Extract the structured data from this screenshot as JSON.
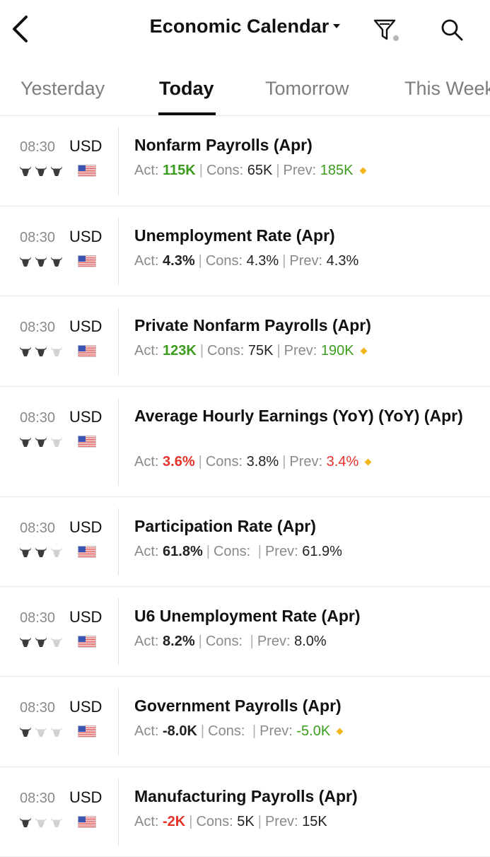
{
  "header": {
    "title": "Economic Calendar"
  },
  "tabs": [
    {
      "label": "Yesterday",
      "active": false
    },
    {
      "label": "Today",
      "active": true
    },
    {
      "label": "Tomorrow",
      "active": false
    },
    {
      "label": "This Week",
      "active": false
    }
  ],
  "icons": {
    "back": "chevron-left-icon",
    "filter": "filter-icon",
    "search": "search-icon",
    "importance": "bull-icon",
    "flag": "us-flag-icon",
    "revised": "diamond-icon"
  },
  "colors": {
    "positive": "#3c9c1e",
    "negative": "#e5332a",
    "diamond": "#f2b51c",
    "muted": "#8a8a8a"
  },
  "labels": {
    "act": "Act:",
    "cons": "Cons:",
    "prev": "Prev:"
  },
  "events": [
    {
      "time": "08:30",
      "currency": "USD",
      "importance": 3,
      "title": "Nonfarm Payrolls (Apr)",
      "actual": "115K",
      "actual_tone": "positive",
      "consensus": "65K",
      "previous": "185K",
      "previous_tone": "positive",
      "revised": true
    },
    {
      "time": "08:30",
      "currency": "USD",
      "importance": 3,
      "title": "Unemployment Rate (Apr)",
      "actual": "4.3%",
      "actual_tone": "neutral",
      "consensus": "4.3%",
      "previous": "4.3%",
      "previous_tone": "neutral",
      "revised": false
    },
    {
      "time": "08:30",
      "currency": "USD",
      "importance": 2,
      "title": "Private Nonfarm Payrolls (Apr)",
      "actual": "123K",
      "actual_tone": "positive",
      "consensus": "75K",
      "previous": "190K",
      "previous_tone": "positive",
      "revised": true
    },
    {
      "time": "08:30",
      "currency": "USD",
      "importance": 2,
      "title": "Average Hourly Earnings (YoY) (YoY) (Apr)",
      "actual": "3.6%",
      "actual_tone": "negative",
      "consensus": "3.8%",
      "previous": "3.4%",
      "previous_tone": "negative",
      "revised": true
    },
    {
      "time": "08:30",
      "currency": "USD",
      "importance": 2,
      "title": "Participation Rate (Apr)",
      "actual": "61.8%",
      "actual_tone": "neutral",
      "consensus": "",
      "previous": "61.9%",
      "previous_tone": "neutral",
      "revised": false
    },
    {
      "time": "08:30",
      "currency": "USD",
      "importance": 2,
      "title": "U6 Unemployment Rate (Apr)",
      "actual": "8.2%",
      "actual_tone": "neutral",
      "consensus": "",
      "previous": "8.0%",
      "previous_tone": "neutral",
      "revised": false
    },
    {
      "time": "08:30",
      "currency": "USD",
      "importance": 1,
      "title": "Government Payrolls (Apr)",
      "actual": "-8.0K",
      "actual_tone": "neutral",
      "consensus": "",
      "previous": "-5.0K",
      "previous_tone": "positive",
      "revised": true
    },
    {
      "time": "08:30",
      "currency": "USD",
      "importance": 1,
      "title": "Manufacturing Payrolls (Apr)",
      "actual": "-2K",
      "actual_tone": "negative",
      "consensus": "5K",
      "previous": "15K",
      "previous_tone": "neutral",
      "revised": false
    }
  ]
}
